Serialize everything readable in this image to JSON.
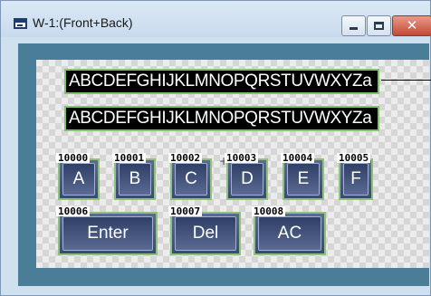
{
  "window": {
    "title": "W-1:(Front+Back)"
  },
  "controls": {
    "minimize_icon": "minimize-icon",
    "maximize_icon": "maximize-icon",
    "close_icon": "close-icon",
    "close_glyph": "✕"
  },
  "displays": [
    {
      "text": "ABCDEFGHIJKLMNOPQRSTUVWXYZa"
    },
    {
      "text": "ABCDEFGHIJKLMNOPQRSTUVWXYZa"
    }
  ],
  "keys": [
    {
      "address": "10000",
      "label": "A"
    },
    {
      "address": "10001",
      "label": "B"
    },
    {
      "address": "10002",
      "label": "C"
    },
    {
      "address": "10003",
      "label": "D"
    },
    {
      "address": "10004",
      "label": "E"
    },
    {
      "address": "10005",
      "label": "F"
    },
    {
      "address": "10006",
      "label": "Enter"
    },
    {
      "address": "10007",
      "label": "Del"
    },
    {
      "address": "10008",
      "label": "AC"
    }
  ],
  "colors": {
    "key_border": "#8ec27a",
    "key_fill": "#3a4a72",
    "display_bg": "#000000",
    "frame": "#4a7e98"
  }
}
